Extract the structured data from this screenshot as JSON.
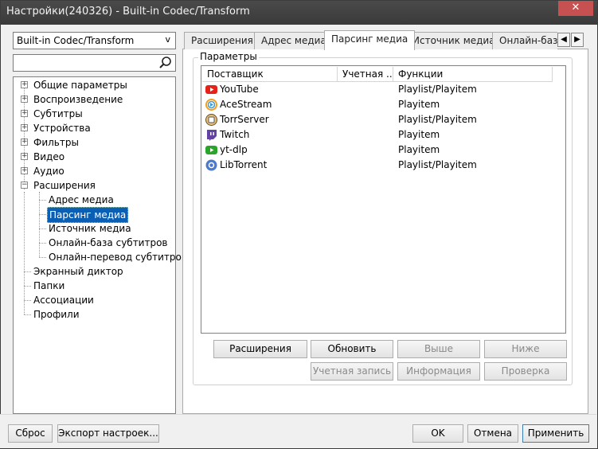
{
  "window": {
    "title": "Настройки(240326) - Built-in Codec/Transform",
    "close_glyph": "✕"
  },
  "left": {
    "combo_value": "Built-in Codec/Transform",
    "combo_arrow": "v",
    "search_placeholder": "",
    "tree": [
      {
        "label": "Общие параметры",
        "expander": "+"
      },
      {
        "label": "Воспроизведение",
        "expander": "+"
      },
      {
        "label": "Субтитры",
        "expander": "+"
      },
      {
        "label": "Устройства",
        "expander": "+"
      },
      {
        "label": "Фильтры",
        "expander": "+"
      },
      {
        "label": "Видео",
        "expander": "+"
      },
      {
        "label": "Аудио",
        "expander": "+"
      },
      {
        "label": "Расширения",
        "expander": "−"
      },
      {
        "label": "Адрес медиа"
      },
      {
        "label": "Парсинг медиа"
      },
      {
        "label": "Источник медиа"
      },
      {
        "label": "Онлайн-база субтитров"
      },
      {
        "label": "Онлайн-перевод субтитров"
      },
      {
        "label": "Экранный диктор"
      },
      {
        "label": "Папки"
      },
      {
        "label": "Ассоциации"
      },
      {
        "label": "Профили"
      }
    ]
  },
  "tabs": [
    "Расширения",
    "Адрес медиа",
    "Парсинг медиа",
    "Источник медиа",
    "Онлайн-база"
  ],
  "tab_nav": {
    "prev": "◀",
    "next": "▶"
  },
  "group": {
    "legend": "Параметры",
    "columns": [
      "Поставщик",
      "Учетная ...",
      "Функции"
    ],
    "rows": [
      {
        "name": "YouTube",
        "functions": "Playlist/Playitem",
        "icon": "youtube-icon"
      },
      {
        "name": "AceStream",
        "functions": "Playitem",
        "icon": "acestream-icon"
      },
      {
        "name": "TorrServer",
        "functions": "Playlist/Playitem",
        "icon": "torrserver-icon"
      },
      {
        "name": "Twitch",
        "functions": "Playitem",
        "icon": "twitch-icon"
      },
      {
        "name": "yt-dlp",
        "functions": "Playitem",
        "icon": "ytdlp-icon"
      },
      {
        "name": "LibTorrent",
        "functions": "Playlist/Playitem",
        "icon": "libtorrent-icon"
      }
    ],
    "buttons": {
      "extensions": "Расширения",
      "update": "Обновить",
      "up": "Выше",
      "down": "Ниже",
      "account": "Учетная запись",
      "info": "Информация",
      "check": "Проверка"
    }
  },
  "footer": {
    "reset": "Сброс",
    "export": "Экспорт настроек...",
    "ok": "OK",
    "cancel": "Отмена",
    "apply": "Применить"
  },
  "colors": {
    "selection": "#0a5fb4",
    "titlebar": "#3a3a3a",
    "close": "#c75050",
    "youtube": "#e62117",
    "twitch": "#6441a5",
    "ytdlp": "#2aa52a",
    "libtorrent": "#4a7bd0"
  }
}
